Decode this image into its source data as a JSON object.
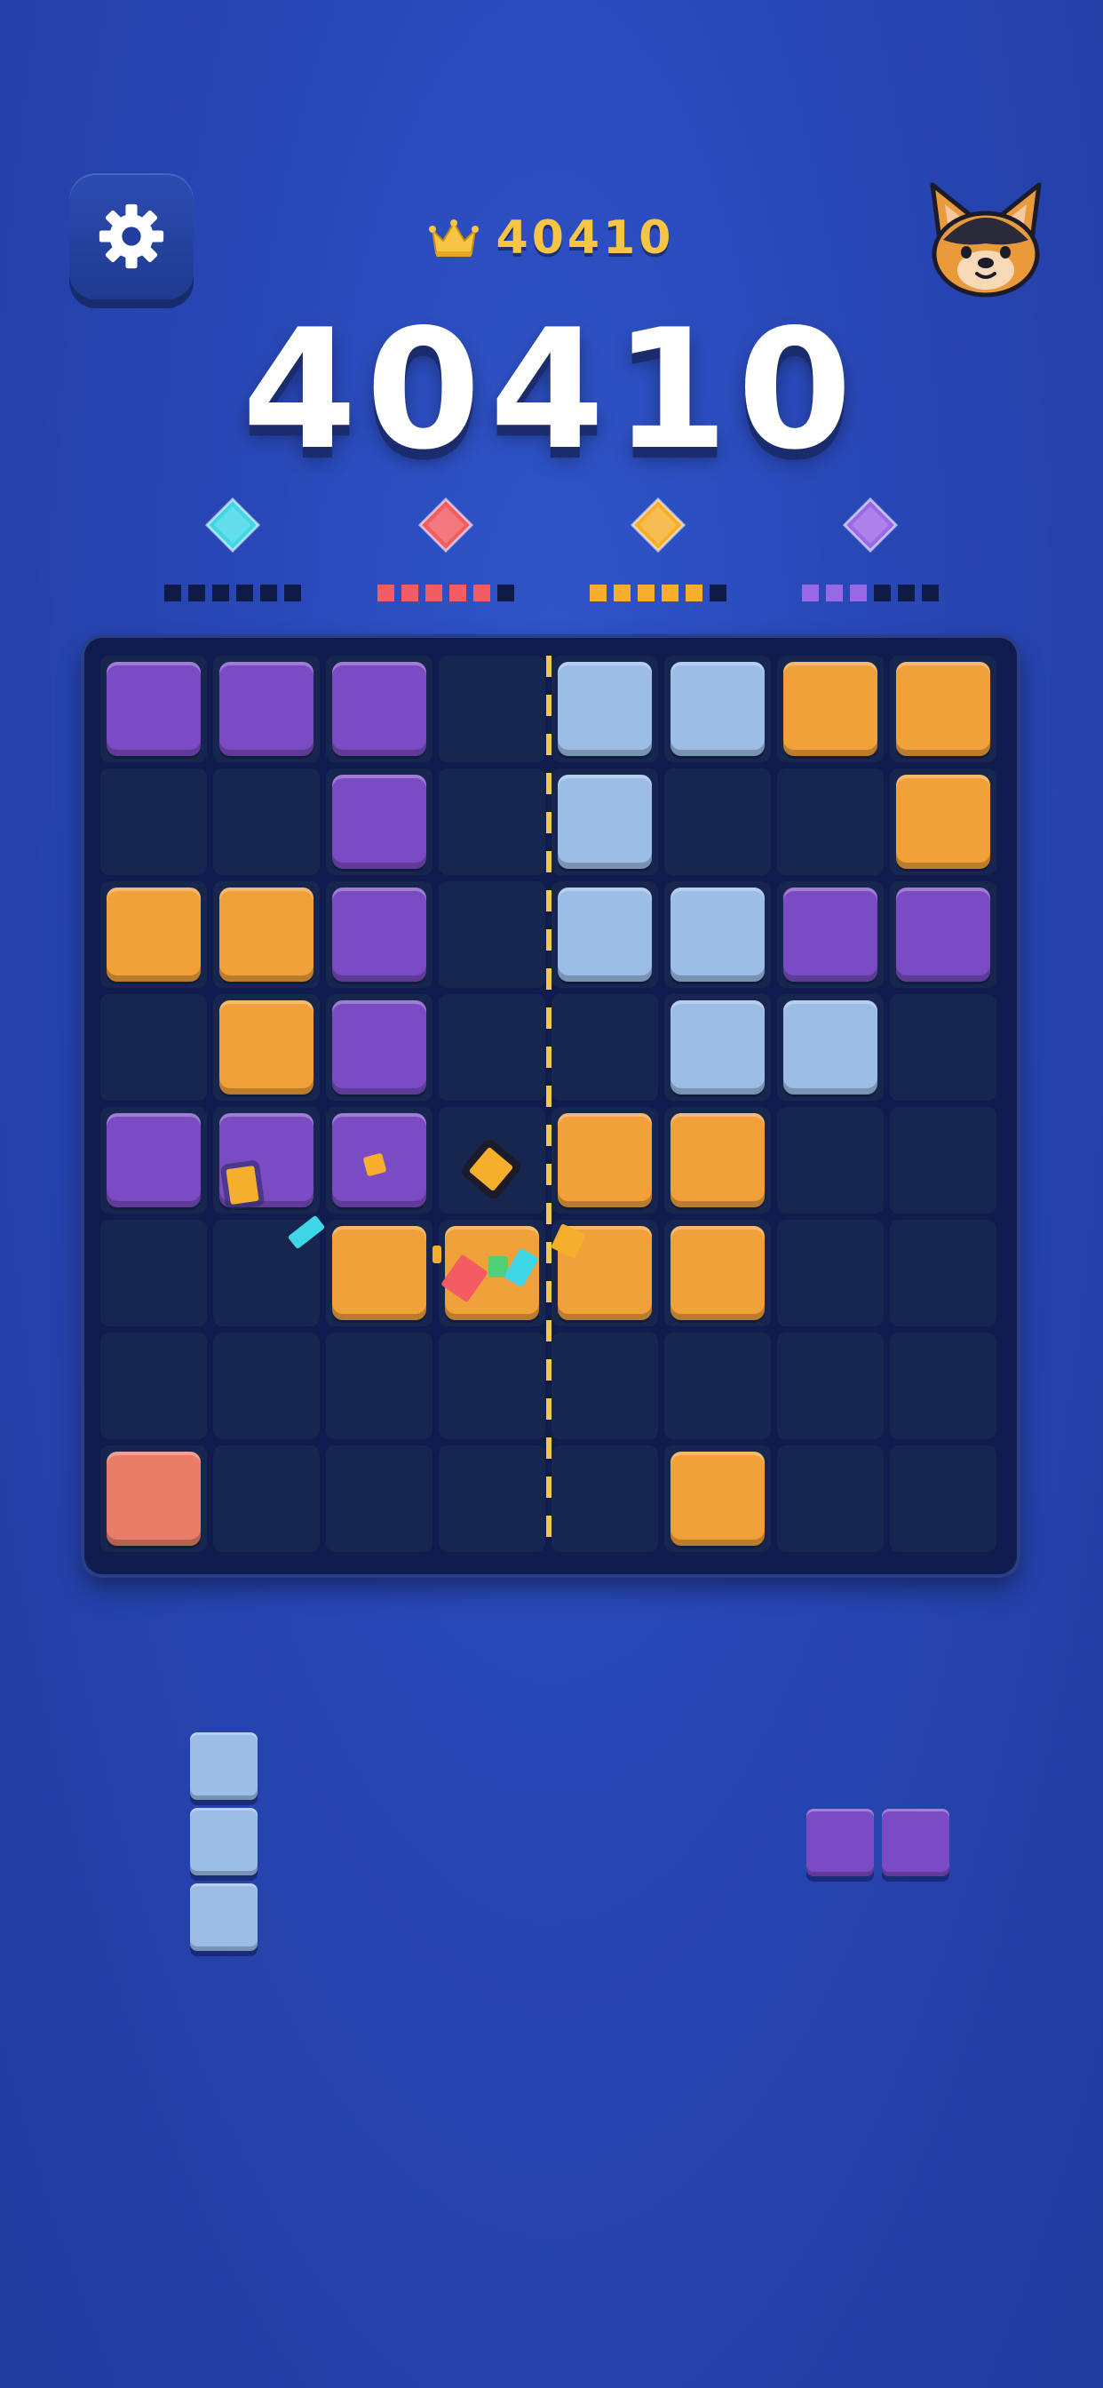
{
  "header": {
    "settings_icon": "gear-icon",
    "best_score_icon": "crown-icon",
    "best_score": "40410",
    "score": "40410",
    "mascot_icon": "dog-face-icon"
  },
  "goals": [
    {
      "name": "cyan",
      "icon": "cyan-diamond-icon",
      "color": "#3fd6e8",
      "filled": 0,
      "total": 6
    },
    {
      "name": "red",
      "icon": "red-diamond-icon",
      "color": "#f25c62",
      "filled": 5,
      "total": 6
    },
    {
      "name": "orange",
      "icon": "orange-diamond-icon",
      "color": "#f6ae2d",
      "filled": 5,
      "total": 6
    },
    {
      "name": "purple",
      "icon": "purple-diamond-icon",
      "color": "#9a67e6",
      "filled": 3,
      "total": 6
    }
  ],
  "colors": {
    "purple": "#7a4bc2",
    "lightblue": "#9bbde6",
    "orange": "#f0a13a",
    "coral": "#e97e68",
    "empty": "#16264f",
    "accent_gold": "#f6c544"
  },
  "board": {
    "rows": [
      [
        "P",
        "P",
        "P",
        ".",
        "L",
        "L",
        "O",
        "O"
      ],
      [
        ".",
        ".",
        "P",
        ".",
        "L",
        ".",
        ".",
        "O"
      ],
      [
        "O",
        "O",
        "P",
        ".",
        "L",
        "L",
        "P",
        "P"
      ],
      [
        ".",
        "O",
        "P",
        ".",
        ".",
        "L",
        "L",
        "."
      ],
      [
        "P",
        "P",
        "P",
        ".",
        "O",
        "O",
        ".",
        "."
      ],
      [
        ".",
        ".",
        "O",
        "O",
        "O",
        "O",
        ".",
        "."
      ],
      [
        ".",
        ".",
        ".",
        ".",
        ".",
        ".",
        ".",
        "."
      ],
      [
        "C",
        ".",
        ".",
        ".",
        ".",
        "O",
        ".",
        "."
      ]
    ]
  },
  "tray": [
    {
      "name": "vertical-i3",
      "color_key": "lightblue",
      "cells": [
        [
          0,
          0
        ],
        [
          1,
          0
        ],
        [
          2,
          0
        ]
      ]
    },
    {
      "name": "horizontal-i2",
      "color_key": "purple",
      "cells": [
        [
          0,
          0
        ],
        [
          0,
          1
        ]
      ]
    }
  ]
}
